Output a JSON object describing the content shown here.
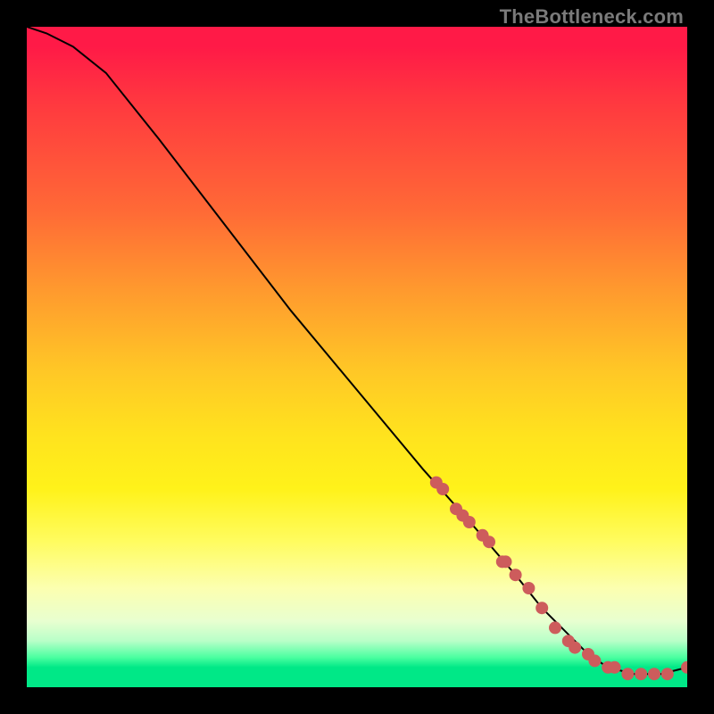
{
  "watermark": "TheBottleneck.com",
  "chart_data": {
    "type": "line",
    "title": "",
    "xlabel": "",
    "ylabel": "",
    "xlim": [
      0,
      100
    ],
    "ylim": [
      0,
      100
    ],
    "grid": false,
    "legend": false,
    "series": [
      {
        "name": "curve",
        "x": [
          0,
          3,
          7,
          12,
          20,
          30,
          40,
          50,
          60,
          68,
          74,
          78,
          82,
          85,
          88,
          92,
          96,
          100
        ],
        "y": [
          100,
          99,
          97,
          93,
          83,
          70,
          57,
          45,
          33,
          24,
          17,
          12,
          8,
          5,
          3,
          2,
          2,
          3
        ]
      }
    ],
    "scatter": [
      {
        "name": "highlight-points",
        "x": [
          62,
          63,
          65,
          66,
          67,
          69,
          70,
          72,
          72.5,
          74,
          76,
          78,
          80,
          82,
          83,
          85,
          86,
          88,
          89,
          91,
          93,
          95,
          97,
          100
        ],
        "y": [
          31,
          30,
          27,
          26,
          25,
          23,
          22,
          19,
          19,
          17,
          15,
          12,
          9,
          7,
          6,
          5,
          4,
          3,
          3,
          2,
          2,
          2,
          2,
          3
        ]
      }
    ],
    "annotations": []
  },
  "colors": {
    "background_frame": "#000000",
    "curve": "#000000",
    "dots": "#cd5c5c",
    "gradient_top": "#ff1a47",
    "gradient_mid": "#ffe31e",
    "gradient_bottom": "#00e887",
    "watermark": "#7a7a7a"
  }
}
